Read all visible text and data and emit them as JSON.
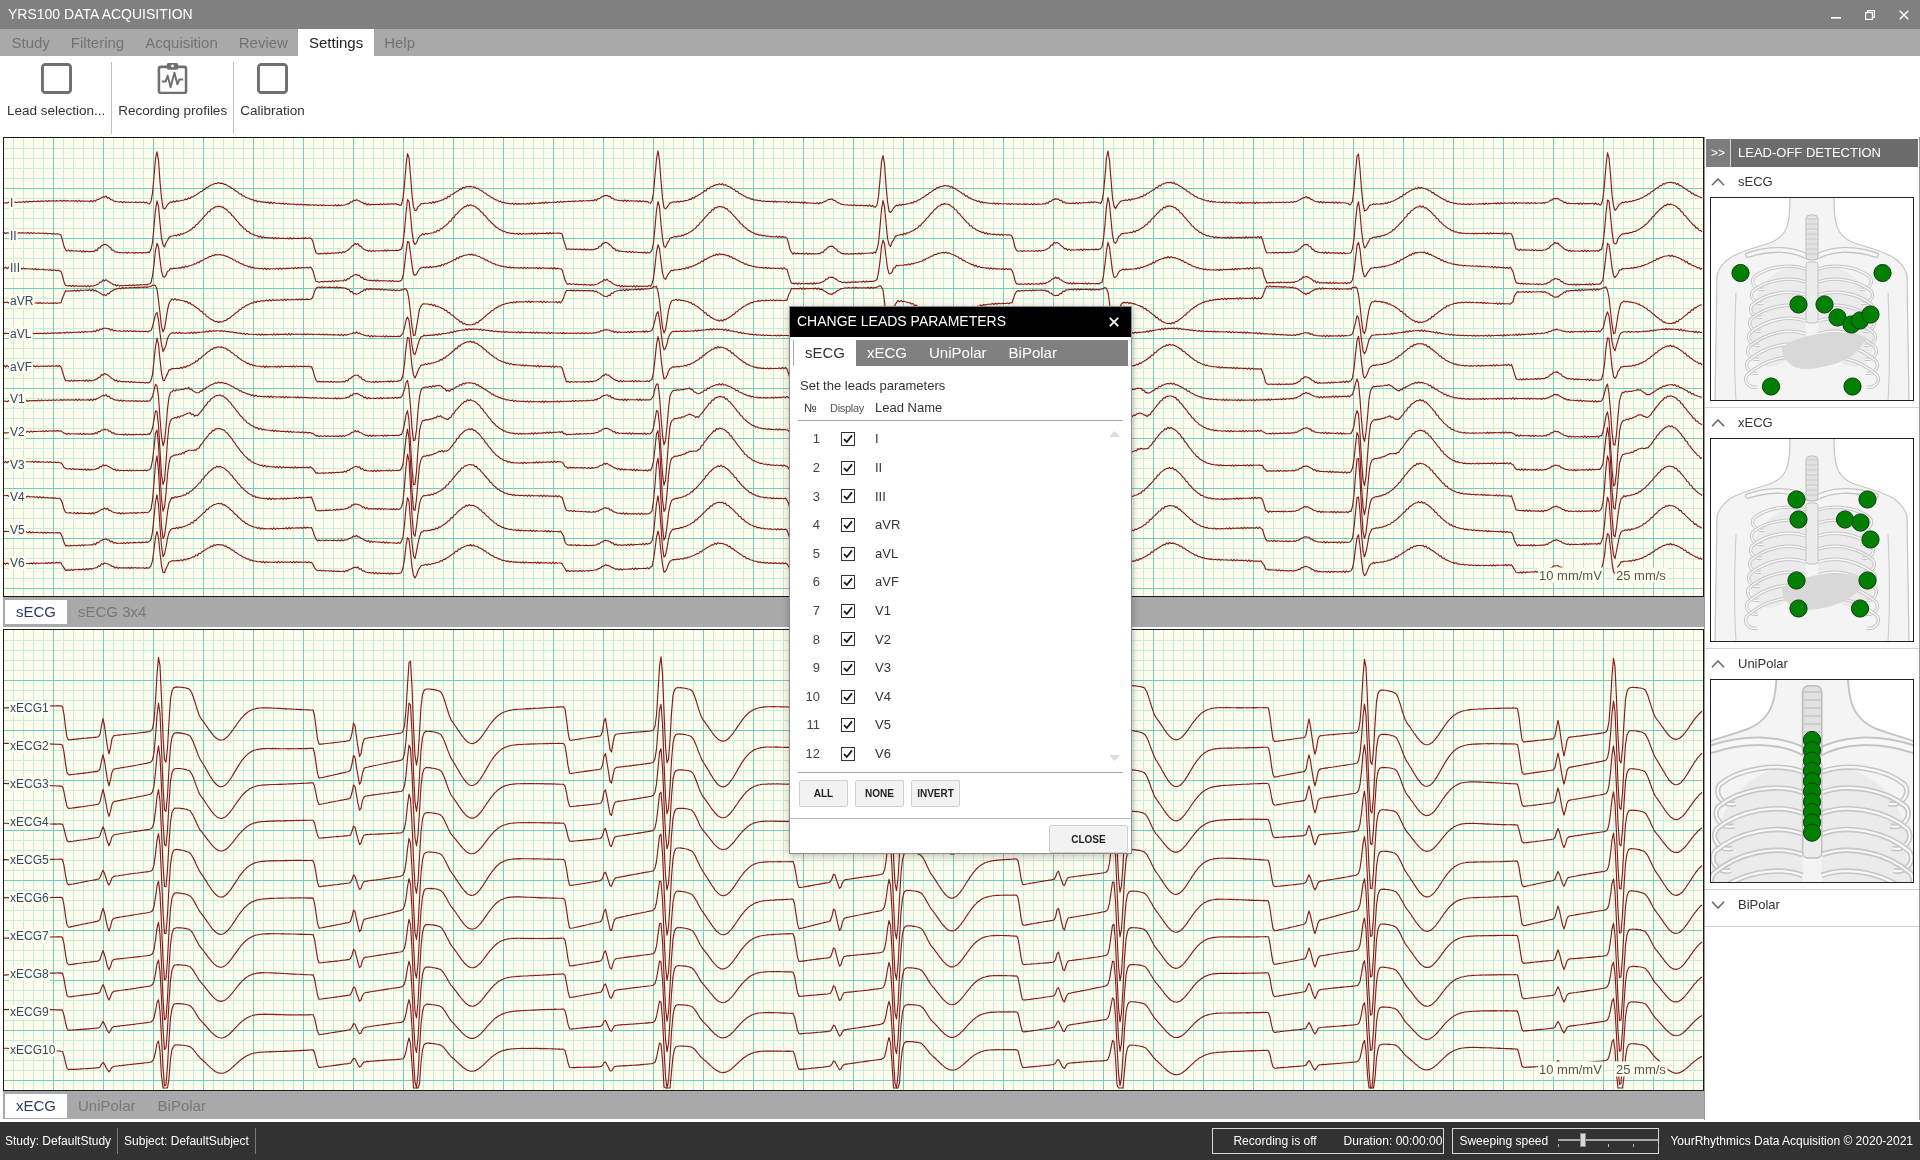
{
  "window": {
    "title": "YRS100 DATA ACQUISITION"
  },
  "menu": [
    {
      "label": "Study",
      "selected": false
    },
    {
      "label": "Filtering",
      "selected": false
    },
    {
      "label": "Acquisition",
      "selected": false
    },
    {
      "label": "Review",
      "selected": false
    },
    {
      "label": "Settings",
      "selected": true
    },
    {
      "label": "Help",
      "selected": false
    }
  ],
  "toolbar": [
    {
      "label": "Lead selection..."
    },
    {
      "label": "Recording profiles"
    },
    {
      "label": "Calibration"
    }
  ],
  "ecg_panels": [
    {
      "kind": "standard",
      "leads": [
        "I",
        "II",
        "III",
        "aVR",
        "aVL",
        "aVF",
        "V1",
        "V2",
        "V3",
        "V4",
        "V5",
        "V6"
      ],
      "scale": "10 mm/mV",
      "speed": "25 mm/s",
      "tabs": [
        {
          "label": "sECG",
          "selected": true
        },
        {
          "label": "sECG 3x4",
          "selected": false
        }
      ]
    },
    {
      "kind": "extended",
      "leads": [
        "xECG1",
        "xECG2",
        "xECG3",
        "xECG4",
        "xECG5",
        "xECG6",
        "xECG7",
        "xECG8",
        "xECG9",
        "xECG10"
      ],
      "scale": "10 mm/mV",
      "speed": "25 mm/s",
      "tabs": [
        {
          "label": "xECG",
          "selected": true
        },
        {
          "label": "UniPolar",
          "selected": false
        },
        {
          "label": "BiPolar",
          "selected": false
        }
      ]
    }
  ],
  "lead_off_detection": {
    "toggle": ">>",
    "title": "LEAD-OFF DETECTION",
    "sections": [
      {
        "kind": "standard",
        "label": "sECG",
        "expanded": true,
        "electrodes": [
          {
            "connected": true
          },
          {
            "connected": true
          },
          {
            "connected": true
          },
          {
            "connected": true
          },
          {
            "connected": true
          },
          {
            "connected": true
          },
          {
            "connected": true
          },
          {
            "connected": true
          },
          {
            "connected": true
          },
          {
            "connected": true
          }
        ]
      },
      {
        "kind": "extended",
        "label": "xECG",
        "expanded": true,
        "electrodes": [
          {
            "connected": true
          },
          {
            "connected": true
          },
          {
            "connected": true
          },
          {
            "connected": true
          },
          {
            "connected": true
          },
          {
            "connected": true
          },
          {
            "connected": true
          },
          {
            "connected": true
          },
          {
            "connected": true
          },
          {
            "connected": true
          }
        ]
      },
      {
        "kind": "unipolar",
        "label": "UniPolar",
        "expanded": true,
        "electrodes": [
          {
            "connected": true
          },
          {
            "connected": true
          },
          {
            "connected": true
          },
          {
            "connected": true
          },
          {
            "connected": true
          },
          {
            "connected": true
          },
          {
            "connected": true
          },
          {
            "connected": true
          },
          {
            "connected": true
          },
          {
            "connected": true
          }
        ]
      },
      {
        "label": "BiPolar",
        "expanded": false
      }
    ]
  },
  "dialog": {
    "title": "CHANGE LEADS PARAMETERS",
    "tabs": [
      {
        "label": "sECG",
        "selected": true
      },
      {
        "label": "xECG",
        "selected": false
      },
      {
        "label": "UniPolar",
        "selected": false
      },
      {
        "label": "BiPolar",
        "selected": false
      }
    ],
    "instruction": "Set the leads parameters",
    "columns": [
      "№",
      "Display",
      "Lead Name"
    ],
    "leads": [
      {
        "number": "1",
        "checked": true,
        "name": "I"
      },
      {
        "number": "2",
        "checked": true,
        "name": "II"
      },
      {
        "number": "3",
        "checked": true,
        "name": "III"
      },
      {
        "number": "4",
        "checked": true,
        "name": "aVR"
      },
      {
        "number": "5",
        "checked": true,
        "name": "aVL"
      },
      {
        "number": "6",
        "checked": true,
        "name": "aVF"
      },
      {
        "number": "7",
        "checked": true,
        "name": "V1"
      },
      {
        "number": "8",
        "checked": true,
        "name": "V2"
      },
      {
        "number": "9",
        "checked": true,
        "name": "V3"
      },
      {
        "number": "10",
        "checked": true,
        "name": "V4"
      },
      {
        "number": "11",
        "checked": true,
        "name": "V5"
      },
      {
        "number": "12",
        "checked": true,
        "name": "V6"
      }
    ],
    "buttons": [
      "ALL",
      "NONE",
      "INVERT"
    ],
    "close_button": "CLOSE"
  },
  "status_bar": {
    "study": "Study: DefaultStudy",
    "subject": "Subject: DefaultSubject",
    "recording": "Recording is off",
    "duration": "Duration: 00:00:00",
    "sweeping_speed": {
      "label": "Sweeping speed",
      "level": 0.25
    },
    "copyright": "YourRhythmics Data Acquisition © 2020-2021"
  }
}
